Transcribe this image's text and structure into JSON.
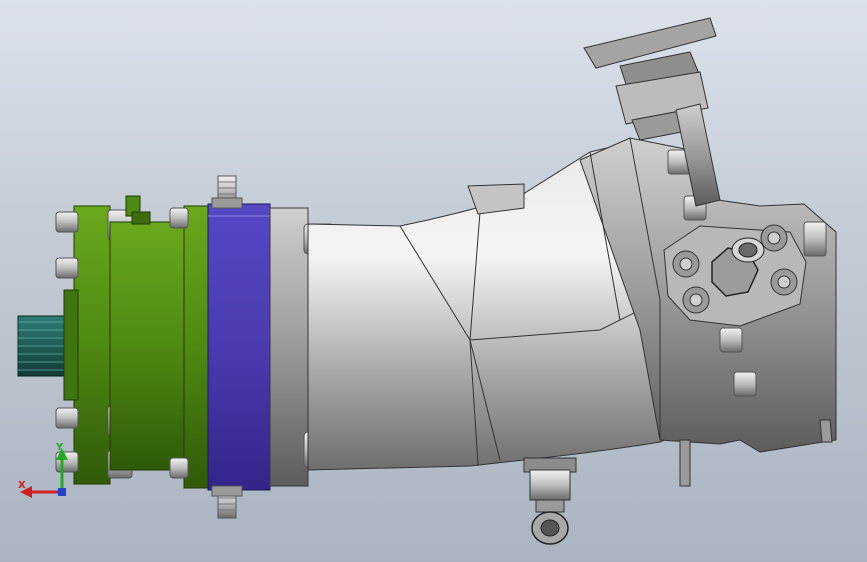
{
  "viewport": {
    "background_top": "#dde2ea",
    "background_bottom": "#aab4c1"
  },
  "model": {
    "parts": [
      {
        "name": "spline-shaft",
        "color": "#1d5f5a"
      },
      {
        "name": "mounting-flange",
        "color": "#4f8a12"
      },
      {
        "name": "front-housing",
        "color": "#4f8a12"
      },
      {
        "name": "end-plate",
        "color": "#4a3bb0"
      },
      {
        "name": "adapter-ring",
        "color": "#c9c9c9"
      },
      {
        "name": "bent-axis-housing",
        "color": "#bdbdbd"
      },
      {
        "name": "valve-block",
        "color": "#9a9a9a"
      },
      {
        "name": "port-flange",
        "color": "#b3b3b3"
      },
      {
        "name": "control-actuator",
        "color": "#8e8e8e"
      },
      {
        "name": "drain-fitting",
        "color": "#a6a6a6"
      }
    ]
  },
  "triad": {
    "x_label": "X",
    "y_label": "Y",
    "x_color": "#cc2222",
    "y_color": "#22aa22",
    "z_color": "#2244cc"
  }
}
